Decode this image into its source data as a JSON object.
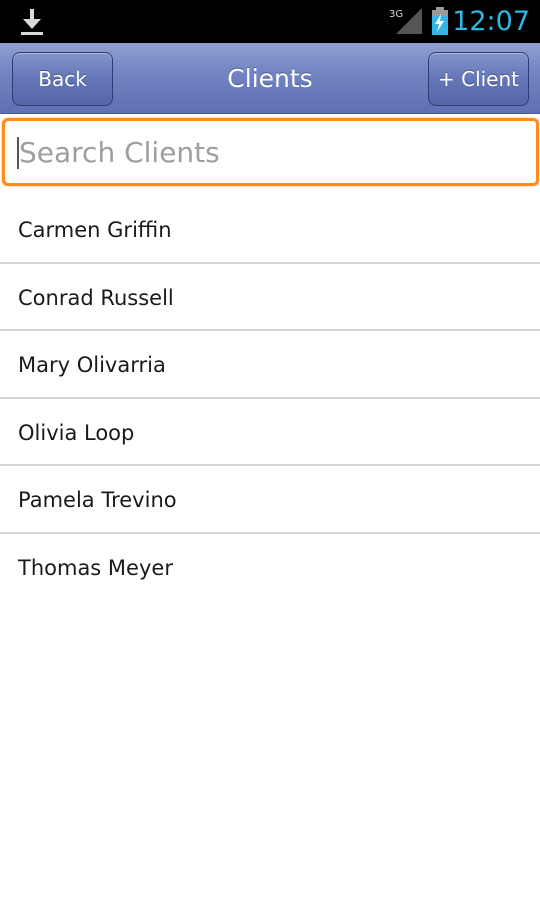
{
  "status_bar": {
    "signal_label": "3G",
    "time": "12:07",
    "accent_color": "#33b5e5"
  },
  "header": {
    "back_label": "Back",
    "title": "Clients",
    "add_label": "+ Client"
  },
  "search": {
    "placeholder": "Search Clients",
    "value": "",
    "focus_color": "#ff8c1a"
  },
  "clients": [
    {
      "name": "Carmen Griffin"
    },
    {
      "name": "Conrad Russell"
    },
    {
      "name": "Mary Olivarria"
    },
    {
      "name": "Olivia Loop"
    },
    {
      "name": "Pamela Trevino"
    },
    {
      "name": "Thomas Meyer"
    }
  ]
}
